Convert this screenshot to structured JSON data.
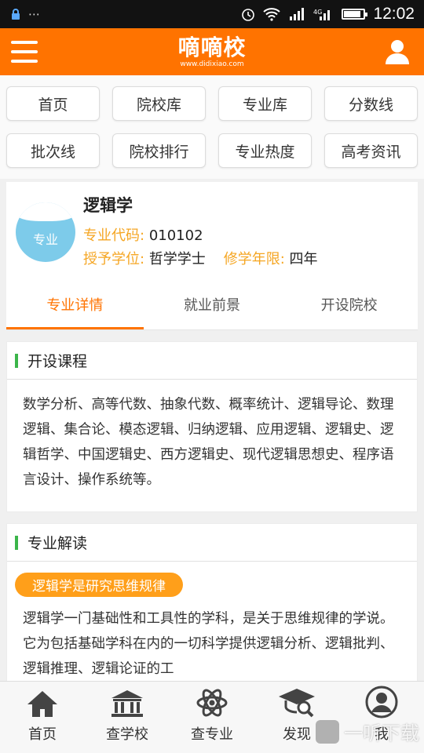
{
  "statusbar": {
    "time": "12:02",
    "signal_glyph": "▴▴▴",
    "notif_glyph": "⋯"
  },
  "header": {
    "logo": "嘀嘀校",
    "url": "www.didixiao.com"
  },
  "nav": [
    "首页",
    "院校库",
    "专业库",
    "分数线",
    "批次线",
    "院校排行",
    "专业热度",
    "高考资讯"
  ],
  "major": {
    "badge": "专业",
    "name": "逻辑学",
    "code_label": "专业代码:",
    "code": "010102",
    "degree_label": "授予学位:",
    "degree": "哲学学士",
    "years_label": "修学年限:",
    "years": "四年"
  },
  "tabs": [
    "专业详情",
    "就业前景",
    "开设院校"
  ],
  "courses": {
    "title": "开设课程",
    "text": "数学分析、高等代数、抽象代数、概率统计、逻辑导论、数理逻辑、集合论、模态逻辑、归纳逻辑、应用逻辑、逻辑史、逻辑哲学、中国逻辑史、西方逻辑史、现代逻辑思想史、程序语言设计、操作系统等。"
  },
  "interpretation": {
    "title": "专业解读",
    "pill": "逻辑学是研究思维规律",
    "text": "逻辑学一门基础性和工具性的学科，是关于思维规律的学说。它为包括基础学科在内的一切科学提供逻辑分析、逻辑批判、逻辑推理、逻辑论证的工"
  },
  "bottom": [
    "首页",
    "查学校",
    "查专业",
    "发现",
    "我"
  ],
  "watermark": "一听下载",
  "colors": {
    "brand": "#ff7300",
    "accent_label": "#f5a623",
    "section_bar": "#3bb54a"
  },
  "battery_level": 0.8
}
